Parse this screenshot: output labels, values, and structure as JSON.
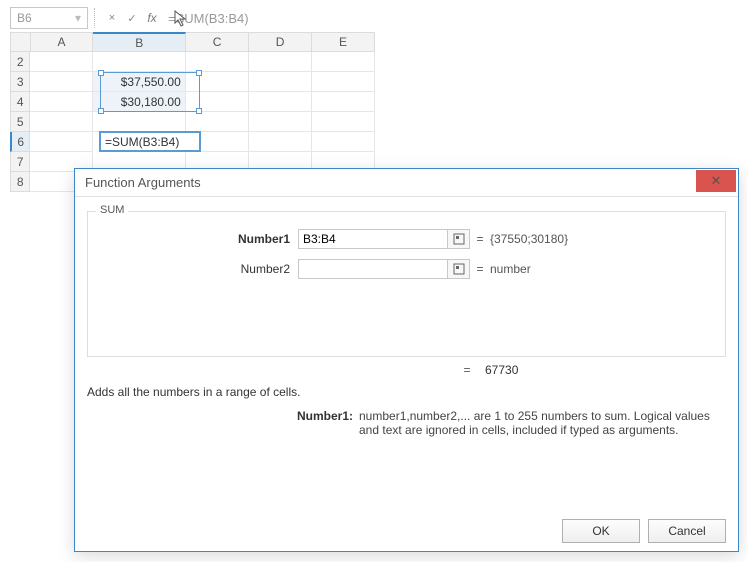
{
  "namebox": {
    "value": "B6"
  },
  "formula_bar": {
    "cancel_glyph": "×",
    "accept_glyph": "✓",
    "fx_label": "fx",
    "formula_text": "=SUM(B3:B4)"
  },
  "columns": [
    "A",
    "B",
    "C",
    "D",
    "E"
  ],
  "rows": [
    "2",
    "3",
    "4",
    "5",
    "6",
    "7",
    "8"
  ],
  "cells": {
    "B3": "$37,550.00",
    "B4": "$30,180.00",
    "B6": "=SUM(B3:B4)"
  },
  "dialog": {
    "title": "Function Arguments",
    "close_glyph": "✕",
    "function_name": "SUM",
    "args": [
      {
        "label": "Number1",
        "bold": true,
        "value": "B3:B4",
        "evaluated": "{37550;30180}"
      },
      {
        "label": "Number2",
        "bold": false,
        "value": "",
        "evaluated": "number"
      }
    ],
    "equals": "=",
    "result": "67730",
    "description": "Adds all the numbers in a range of cells.",
    "param_name": "Number1:",
    "param_text": "number1,number2,... are 1 to 255 numbers to sum. Logical values and text are ignored in cells, included if typed as arguments.",
    "ok_label": "OK",
    "cancel_label": "Cancel"
  }
}
